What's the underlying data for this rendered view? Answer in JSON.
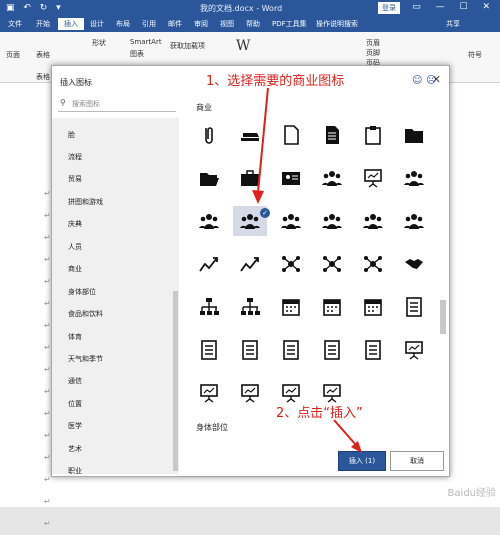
{
  "window": {
    "title": "我的文档.docx - Word",
    "login": "登录",
    "share": "共享"
  },
  "ribbon_tabs": [
    "文件",
    "开始",
    "插入",
    "设计",
    "布局",
    "引用",
    "邮件",
    "审阅",
    "视图",
    "帮助",
    "PDF工具集",
    "操作说明搜索"
  ],
  "ribbon_items": [
    "形状",
    "SmartArt",
    "图表",
    "获取加载项",
    "页眉",
    "页脚",
    "页码",
    "符号",
    "页面",
    "表格",
    "表格"
  ],
  "dialog": {
    "title": "插入图标",
    "search_placeholder": "搜索图标",
    "categories": [
      "脸",
      "流程",
      "贸易",
      "拼图和游戏",
      "庆典",
      "人员",
      "商业",
      "身体部位",
      "食品和饮料",
      "体育",
      "天气和季节",
      "通信",
      "位置",
      "医学",
      "艺术",
      "职业"
    ],
    "section_business": "商业",
    "section_body": "身体部位",
    "insert_button": "插入 (1)",
    "cancel_button": "取消"
  },
  "icons": [
    "paperclip-icon",
    "stapler-icon",
    "document-icon",
    "document-lines-icon",
    "clipboard-icon",
    "folder-icon",
    "open-folder-icon",
    "briefcase-icon",
    "id-card-icon",
    "meeting-icon",
    "presentation-people-icon",
    "chat-team-icon",
    "team-speech-icon",
    "idea-person-icon",
    "group-icon",
    "question-person-icon",
    "money-person-icon",
    "flag-person-icon",
    "growth-arrows-icon",
    "growth-arrows-2-icon",
    "network-icon",
    "network-2-icon",
    "network-3-icon",
    "handshake-icon",
    "org-chart-icon",
    "org-chart-2-icon",
    "calendar-icon",
    "calendar-2-icon",
    "calendar-3-icon",
    "checklist-icon",
    "checklist-2-icon",
    "checklist-3-icon",
    "checklist-4-icon",
    "checklist-5-icon",
    "checklist-6-icon",
    "presentation-icon",
    "presentation-chart-icon",
    "presentation-team-icon",
    "presentation-play-icon",
    "easel-icon"
  ],
  "annotations": {
    "step1": "1、选择需要的商业图标",
    "step2": "2、点击“插入”"
  },
  "watermark": "Baidu经验",
  "colors": {
    "accent": "#2b579a",
    "annotation": "#e0201a"
  }
}
